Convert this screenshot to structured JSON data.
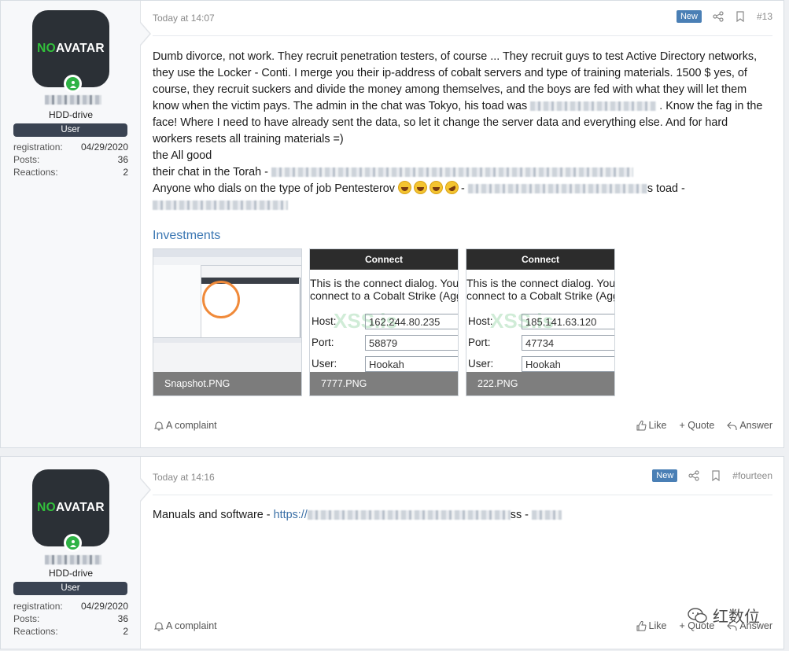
{
  "posts": [
    {
      "user": {
        "avatar_text_1": "NO",
        "avatar_text_2": "AVATAR",
        "title": "HDD-drive",
        "banner": "User",
        "stats": [
          {
            "label": "registration:",
            "value": "04/29/2020"
          },
          {
            "label": "Posts:",
            "value": "36"
          },
          {
            "label": "Reactions:",
            "value": "2"
          }
        ]
      },
      "date": "Today at 14:07",
      "badge": "New",
      "number": "#13",
      "lines": [
        "Dumb divorce, not work. They recruit penetration testers, of course ... They recruit guys to test Active Directory networks, they use the Locker - Conti. I merge you their ip-address of cobalt servers and type of training materials. 1500 $ yes, of course, they recruit suckers and divide the money among themselves, and the boys are fed with what they will let them know when the victim pays. The admin in the chat was Tokyo, his toad was",
        ". Know the fag in the face! Where I need to have already sent the data, so let it change the server data and everything else. And for hard workers resets all training materials =)",
        "the All good",
        "their chat in the Torah -",
        "Anyone who dials on the type of job Pentesterov",
        "-",
        "s toad -"
      ],
      "attachments_title": "Investments",
      "attachments": [
        {
          "name": "Snapshot.PNG"
        },
        {
          "name": "7777.PNG",
          "dialog_title": "Connect",
          "dialog_text_1": "This is the connect dialog. You",
          "dialog_text_2": "connect to a Cobalt Strike (Agg",
          "host": "162.244.80.235",
          "port": "58879",
          "user": "Hookah",
          "host_label": "Host:",
          "port_label": "Port:",
          "user_label": "User:",
          "watermark": "XSS.is"
        },
        {
          "name": "222.PNG",
          "dialog_title": "Connect",
          "dialog_text_1": "This is the connect dialog. You",
          "dialog_text_2": "connect to a Cobalt Strike (Agg",
          "host": "185.141.63.120",
          "port": "47734",
          "user": "Hookah",
          "host_label": "Host:",
          "port_label": "Port:",
          "user_label": "User:",
          "watermark": "XSS.is"
        }
      ],
      "complaint": "A complaint",
      "like": "Like",
      "quote": "+ Quote",
      "answer": "Answer"
    },
    {
      "user": {
        "avatar_text_1": "NO",
        "avatar_text_2": "AVATAR",
        "title": "HDD-drive",
        "banner": "User",
        "stats": [
          {
            "label": "registration:",
            "value": "04/29/2020"
          },
          {
            "label": "Posts:",
            "value": "36"
          },
          {
            "label": "Reactions:",
            "value": "2"
          }
        ]
      },
      "date": "Today at 14:16",
      "badge": "New",
      "number": "#fourteen",
      "text_prefix": "Manuals and software - ",
      "link_prefix": "https://",
      "text_mid": "ss -",
      "complaint": "A complaint",
      "like": "Like",
      "quote": "+ Quote",
      "answer": "Answer"
    }
  ],
  "watermark_text": "红数位"
}
